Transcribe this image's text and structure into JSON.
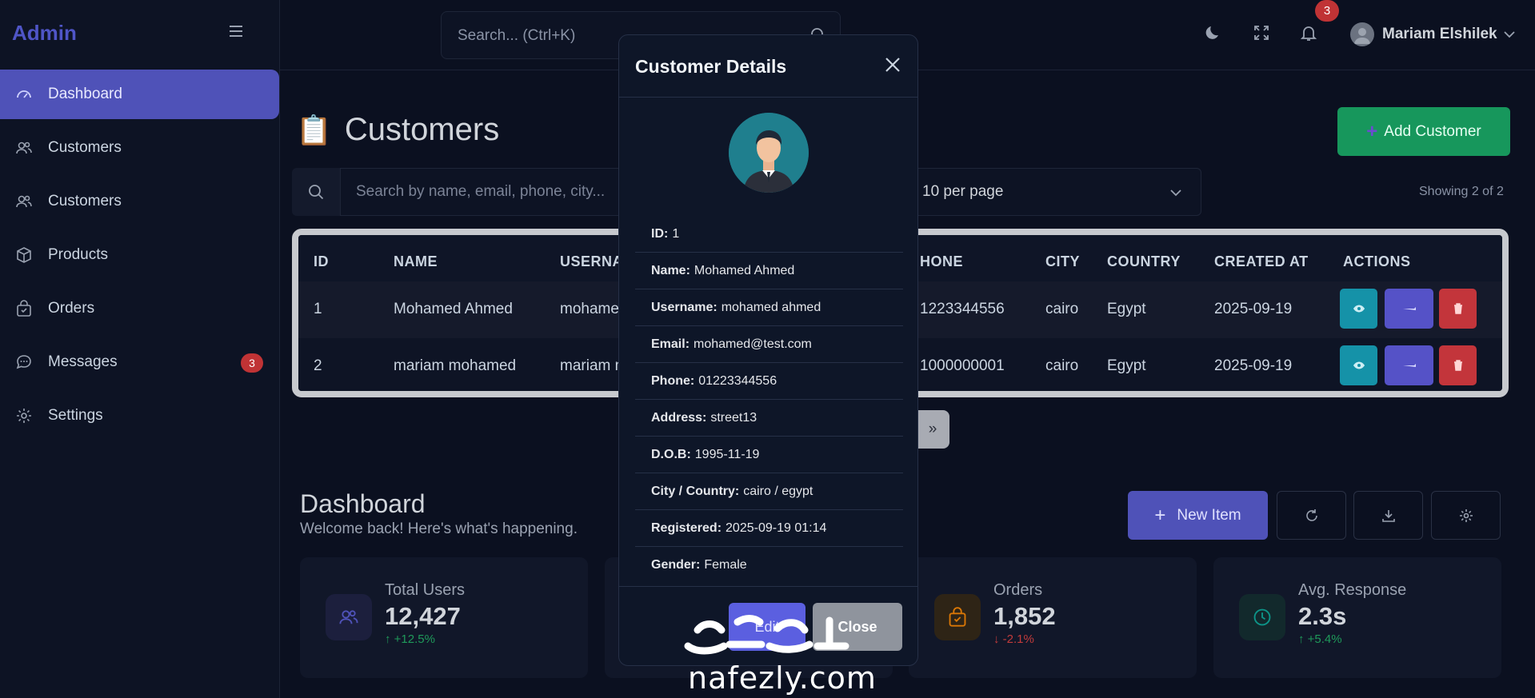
{
  "brand": "Admin",
  "sidebar": {
    "items": [
      {
        "label": "Dashboard",
        "icon": "gauge-icon",
        "active": true
      },
      {
        "label": "Customers",
        "icon": "users-icon"
      },
      {
        "label": "Customers",
        "icon": "users-icon"
      },
      {
        "label": "Products",
        "icon": "box-icon"
      },
      {
        "label": "Orders",
        "icon": "bag-icon"
      },
      {
        "label": "Messages",
        "icon": "chat-icon",
        "badge": "3"
      },
      {
        "label": "Settings",
        "icon": "gear-icon"
      }
    ]
  },
  "topbar": {
    "search_placeholder": "Search... (Ctrl+K)",
    "notification_count": "3",
    "user_name": "Mariam Elshilek"
  },
  "page": {
    "title": "Customers",
    "title_icon": "📋",
    "add_button": "Add Customer",
    "search_placeholder": "Search by name, email, phone, city...",
    "per_page": "10 per page",
    "showing": "Showing 2 of 2"
  },
  "table": {
    "headers": [
      "ID",
      "NAME",
      "USERNAM",
      "HONE",
      "CITY",
      "COUNTRY",
      "CREATED AT",
      "ACTIONS"
    ],
    "rows": [
      {
        "id": "1",
        "name": "Mohamed Ahmed",
        "username": "mohamed",
        "phone": "1223344556",
        "city": "cairo",
        "country": "Egypt",
        "created": "2025-09-19"
      },
      {
        "id": "2",
        "name": "mariam mohamed",
        "username": "mariam m",
        "phone": "1000000001",
        "city": "cairo",
        "country": "Egypt",
        "created": "2025-09-19"
      }
    ]
  },
  "pager": {
    "next": "»"
  },
  "dashboard": {
    "title": "Dashboard",
    "subtitle": "Welcome back! Here's what's happening.",
    "new_item": "New Item",
    "cards": [
      {
        "label": "Total Users",
        "value": "12,427",
        "change": "↑ +12.5%",
        "icon": "users-icon",
        "color": "#4f52b8"
      },
      {
        "label": "Orders",
        "value": "1,852",
        "change": "↓ -2.1%",
        "icon": "bag-icon",
        "color": "#d97706"
      },
      {
        "label": "Avg. Response",
        "value": "2.3s",
        "change": "↑ +5.4%",
        "icon": "clock-icon",
        "color": "#0d9488"
      }
    ]
  },
  "modal": {
    "title": "Customer Details",
    "fields": [
      {
        "label": "ID:",
        "value": "1"
      },
      {
        "label": "Name:",
        "value": "Mohamed Ahmed"
      },
      {
        "label": "Username:",
        "value": "mohamed ahmed"
      },
      {
        "label": "Email:",
        "value": "mohamed@test.com"
      },
      {
        "label": "Phone:",
        "value": "01223344556"
      },
      {
        "label": "Address:",
        "value": "street13"
      },
      {
        "label": "D.O.B:",
        "value": "1995-11-19"
      },
      {
        "label": "City / Country:",
        "value": "cairo / egypt"
      },
      {
        "label": "Registered:",
        "value": "2025-09-19 01:14"
      },
      {
        "label": "Gender:",
        "value": "Female"
      }
    ],
    "edit_button": "Edit",
    "close_button": "Close"
  },
  "watermark": {
    "text": "nafezly.com"
  }
}
